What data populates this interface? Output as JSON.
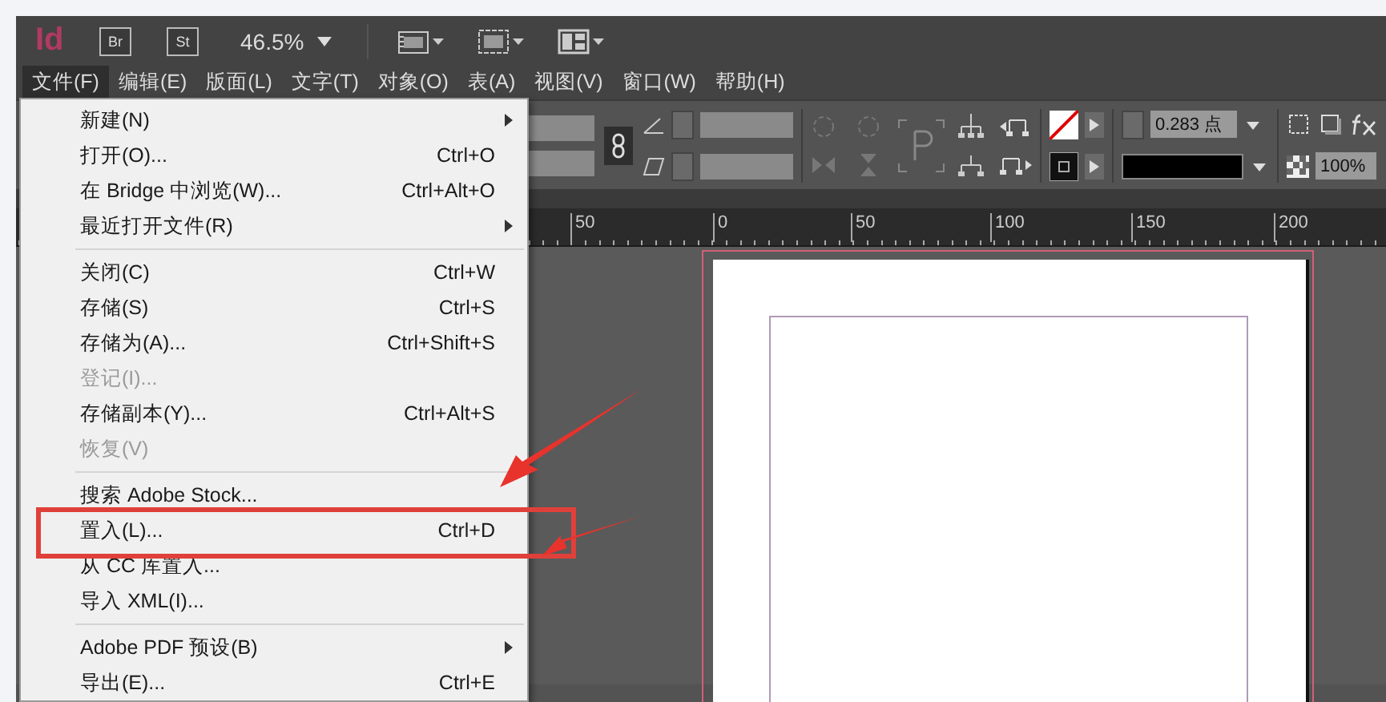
{
  "app": {
    "logo": "Id",
    "bridge_button": "Br",
    "stock_button": "St",
    "zoom": "46.5%"
  },
  "menubar": [
    {
      "label": "文件(F)",
      "selected": true
    },
    {
      "label": "编辑(E)",
      "selected": false
    },
    {
      "label": "版面(L)",
      "selected": false
    },
    {
      "label": "文字(T)",
      "selected": false
    },
    {
      "label": "对象(O)",
      "selected": false
    },
    {
      "label": "表(A)",
      "selected": false
    },
    {
      "label": "视图(V)",
      "selected": false
    },
    {
      "label": "窗口(W)",
      "selected": false
    },
    {
      "label": "帮助(H)",
      "selected": false
    }
  ],
  "file_menu": [
    [
      {
        "label": "新建(N)",
        "submenu": true,
        "disabled": false
      },
      {
        "label": "打开(O)...",
        "shortcut": "Ctrl+O",
        "submenu": false,
        "disabled": false
      },
      {
        "label": "在 Bridge 中浏览(W)...",
        "shortcut": "Ctrl+Alt+O",
        "submenu": false,
        "disabled": false
      },
      {
        "label": "最近打开文件(R)",
        "submenu": true,
        "disabled": false
      }
    ],
    [
      {
        "label": "关闭(C)",
        "shortcut": "Ctrl+W",
        "submenu": false,
        "disabled": false
      },
      {
        "label": "存储(S)",
        "shortcut": "Ctrl+S",
        "submenu": false,
        "disabled": false
      },
      {
        "label": "存储为(A)...",
        "shortcut": "Ctrl+Shift+S",
        "submenu": false,
        "disabled": false
      },
      {
        "label": "登记(I)...",
        "submenu": false,
        "disabled": true
      },
      {
        "label": "存储副本(Y)...",
        "shortcut": "Ctrl+Alt+S",
        "submenu": false,
        "disabled": false
      },
      {
        "label": "恢复(V)",
        "submenu": false,
        "disabled": true
      }
    ],
    [
      {
        "label": "搜索 Adobe Stock...",
        "submenu": false,
        "disabled": false
      },
      {
        "label": "置入(L)...",
        "shortcut": "Ctrl+D",
        "submenu": false,
        "disabled": false
      },
      {
        "label": "从 CC 库置入...",
        "submenu": false,
        "disabled": false
      },
      {
        "label": "导入 XML(I)...",
        "submenu": false,
        "disabled": false
      }
    ],
    [
      {
        "label": "Adobe PDF 预设(B)",
        "submenu": true,
        "disabled": false
      },
      {
        "label": "导出(E)...",
        "shortcut": "Ctrl+E",
        "submenu": false,
        "disabled": false
      }
    ]
  ],
  "control_panel": {
    "stroke_weight": "0.283 点",
    "opacity": "100%"
  },
  "ruler": [
    "50",
    "0",
    "50",
    "100",
    "150",
    "200"
  ]
}
